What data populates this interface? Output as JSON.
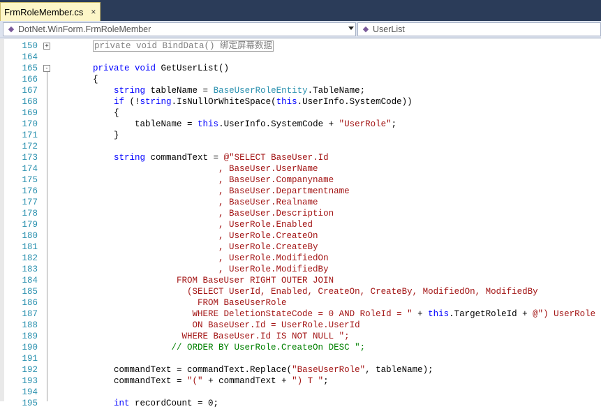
{
  "tab": {
    "title": "FrmRoleMember.cs",
    "close": "×"
  },
  "nav": {
    "left_combo": "DotNet.WinForm.FrmRoleMember",
    "right_combo": "UserList"
  },
  "colors": {
    "keyword": "#0000ff",
    "type": "#2b91af",
    "string": "#a31515",
    "comment": "#008000",
    "line_number": "#2b91af"
  },
  "lines": [
    {
      "n": "150",
      "fold": "+",
      "tokens": [
        {
          "t": "        "
        },
        {
          "t": "private void BindData() 绑定屏幕数据",
          "c": "collapsed"
        }
      ]
    },
    {
      "n": "164",
      "tokens": []
    },
    {
      "n": "165",
      "fold": "-",
      "tokens": [
        {
          "t": "        "
        },
        {
          "t": "private void",
          "c": "kw"
        },
        {
          "t": " GetUserList()"
        }
      ]
    },
    {
      "n": "166",
      "tokens": [
        {
          "t": "        {"
        }
      ]
    },
    {
      "n": "167",
      "tokens": [
        {
          "t": "            "
        },
        {
          "t": "string",
          "c": "kw"
        },
        {
          "t": " tableName = "
        },
        {
          "t": "BaseUserRoleEntity",
          "c": "ty"
        },
        {
          "t": ".TableName;"
        }
      ]
    },
    {
      "n": "168",
      "tokens": [
        {
          "t": "            "
        },
        {
          "t": "if",
          "c": "kw"
        },
        {
          "t": " (!"
        },
        {
          "t": "string",
          "c": "kw"
        },
        {
          "t": ".IsNullOrWhiteSpace("
        },
        {
          "t": "this",
          "c": "kw"
        },
        {
          "t": ".UserInfo.SystemCode))"
        }
      ]
    },
    {
      "n": "169",
      "tokens": [
        {
          "t": "            {"
        }
      ]
    },
    {
      "n": "170",
      "tokens": [
        {
          "t": "                tableName = "
        },
        {
          "t": "this",
          "c": "kw"
        },
        {
          "t": ".UserInfo.SystemCode + "
        },
        {
          "t": "\"UserRole\"",
          "c": "str"
        },
        {
          "t": ";"
        }
      ]
    },
    {
      "n": "171",
      "tokens": [
        {
          "t": "            }"
        }
      ]
    },
    {
      "n": "172",
      "tokens": []
    },
    {
      "n": "173",
      "tokens": [
        {
          "t": "            "
        },
        {
          "t": "string",
          "c": "kw"
        },
        {
          "t": " commandText = "
        },
        {
          "t": "@\"SELECT BaseUser.Id",
          "c": "str"
        }
      ]
    },
    {
      "n": "174",
      "tokens": [
        {
          "t": "                                , BaseUser.UserName",
          "c": "str"
        }
      ]
    },
    {
      "n": "175",
      "tokens": [
        {
          "t": "                                , BaseUser.Companyname",
          "c": "str"
        }
      ]
    },
    {
      "n": "176",
      "tokens": [
        {
          "t": "                                , BaseUser.Departmentname",
          "c": "str"
        }
      ]
    },
    {
      "n": "177",
      "tokens": [
        {
          "t": "                                , BaseUser.Realname",
          "c": "str"
        }
      ]
    },
    {
      "n": "178",
      "tokens": [
        {
          "t": "                                , BaseUser.Description",
          "c": "str"
        }
      ]
    },
    {
      "n": "179",
      "tokens": [
        {
          "t": "                                , UserRole.Enabled",
          "c": "str"
        }
      ]
    },
    {
      "n": "180",
      "tokens": [
        {
          "t": "                                , UserRole.CreateOn",
          "c": "str"
        }
      ]
    },
    {
      "n": "181",
      "tokens": [
        {
          "t": "                                , UserRole.CreateBy",
          "c": "str"
        }
      ]
    },
    {
      "n": "182",
      "tokens": [
        {
          "t": "                                , UserRole.ModifiedOn",
          "c": "str"
        }
      ]
    },
    {
      "n": "183",
      "tokens": [
        {
          "t": "                                , UserRole.ModifiedBy",
          "c": "str"
        }
      ]
    },
    {
      "n": "184",
      "tokens": [
        {
          "t": "                        FROM BaseUser RIGHT OUTER JOIN",
          "c": "str"
        }
      ]
    },
    {
      "n": "185",
      "tokens": [
        {
          "t": "                          (SELECT UserId, Enabled, CreateOn, CreateBy, ModifiedOn, ModifiedBy",
          "c": "str"
        }
      ]
    },
    {
      "n": "186",
      "tokens": [
        {
          "t": "                            FROM BaseUserRole",
          "c": "str"
        }
      ]
    },
    {
      "n": "187",
      "tokens": [
        {
          "t": "                           WHERE DeletionStateCode = 0 AND RoleId = \"",
          "c": "str"
        },
        {
          "t": " + "
        },
        {
          "t": "this",
          "c": "kw"
        },
        {
          "t": ".TargetRoleId + "
        },
        {
          "t": "@\") UserRole",
          "c": "str"
        }
      ]
    },
    {
      "n": "188",
      "tokens": [
        {
          "t": "                           ON BaseUser.Id = UserRole.UserId",
          "c": "str"
        }
      ]
    },
    {
      "n": "189",
      "tokens": [
        {
          "t": "                         WHERE BaseUser.Id IS NOT NULL \";",
          "c": "str"
        }
      ]
    },
    {
      "n": "190",
      "tokens": [
        {
          "t": "                       // ORDER BY UserRole.CreateOn DESC \";",
          "c": "cm"
        }
      ]
    },
    {
      "n": "191",
      "tokens": []
    },
    {
      "n": "192",
      "tokens": [
        {
          "t": "            commandText = commandText.Replace("
        },
        {
          "t": "\"BaseUserRole\"",
          "c": "str"
        },
        {
          "t": ", tableName);"
        }
      ]
    },
    {
      "n": "193",
      "tokens": [
        {
          "t": "            commandText = "
        },
        {
          "t": "\"(\"",
          "c": "str"
        },
        {
          "t": " + commandText + "
        },
        {
          "t": "\") T \"",
          "c": "str"
        },
        {
          "t": ";"
        }
      ]
    },
    {
      "n": "194",
      "tokens": []
    },
    {
      "n": "195",
      "tokens": [
        {
          "t": "            "
        },
        {
          "t": "int",
          "c": "kw"
        },
        {
          "t": " recordCount = 0;"
        }
      ]
    }
  ]
}
